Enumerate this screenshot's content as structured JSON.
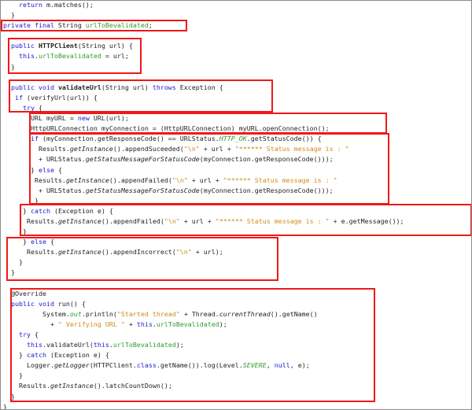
{
  "highlight_color": "#f01818",
  "lines": [
    [
      [
        "    return",
        "k"
      ],
      [
        " m.matches();",
        ""
      ]
    ],
    [
      [
        "  }",
        ""
      ]
    ],
    [
      [
        "private final",
        "k"
      ],
      [
        " String ",
        ""
      ],
      [
        "urlToBevalidated",
        "f"
      ],
      [
        ";",
        ""
      ]
    ],
    [],
    [
      [
        "  public",
        "k"
      ],
      [
        " ",
        ""
      ],
      [
        "HTTPClient",
        "b"
      ],
      [
        "(String url) {",
        ""
      ]
    ],
    [
      [
        "    this",
        "k"
      ],
      [
        ".",
        ""
      ],
      [
        "urlToBevalidated",
        "f"
      ],
      [
        " = url;",
        ""
      ]
    ],
    [
      [
        "  }",
        ""
      ]
    ],
    [],
    [
      [
        "  public void",
        "k"
      ],
      [
        " ",
        ""
      ],
      [
        "validateUrl",
        "b"
      ],
      [
        "(String url) ",
        ""
      ],
      [
        "throws",
        "k"
      ],
      [
        " Exception {",
        ""
      ]
    ],
    [
      [
        "   if",
        "k"
      ],
      [
        " (verifyUrl(url)) {",
        ""
      ]
    ],
    [
      [
        "     try",
        "k"
      ],
      [
        " {",
        ""
      ]
    ],
    [
      [
        "       URL myURL = ",
        ""
      ],
      [
        "new",
        "k"
      ],
      [
        " URL(url);",
        ""
      ]
    ],
    [
      [
        "       HttpURLConnection myConnection = (HttpURLConnection) myURL.openConnection();",
        ""
      ]
    ],
    [
      [
        "       if",
        "k"
      ],
      [
        " (myConnection.getResponseCode() == URLStatus.",
        ""
      ],
      [
        "HTTP_OK",
        "fi"
      ],
      [
        ".getStatusCode()) {",
        ""
      ]
    ],
    [
      [
        "         Results.",
        ""
      ],
      [
        "getInstance",
        "i"
      ],
      [
        "().appendSuceeded(",
        ""
      ],
      [
        "\"\\n\"",
        "s"
      ],
      [
        " + url + ",
        ""
      ],
      [
        "\"****** Status message is : \"",
        "s"
      ]
    ],
    [
      [
        "         + URLStatus.",
        ""
      ],
      [
        "getStatusMessageForStatusCode",
        "i"
      ],
      [
        "(myConnection.getResponseCode()));",
        ""
      ]
    ],
    [
      [
        "       } ",
        ""
      ],
      [
        "else",
        "k"
      ],
      [
        " {",
        ""
      ]
    ],
    [
      [
        "        Results.",
        ""
      ],
      [
        "getInstance",
        "i"
      ],
      [
        "().appendFailed(",
        ""
      ],
      [
        "\"\\n\"",
        "s"
      ],
      [
        " + url + ",
        ""
      ],
      [
        "\"****** Status message is : \"",
        "s"
      ]
    ],
    [
      [
        "         + URLStatus.",
        ""
      ],
      [
        "getStatusMessageForStatusCode",
        "i"
      ],
      [
        "(myConnection.getResponseCode()));",
        ""
      ]
    ],
    [
      [
        "        }",
        ""
      ]
    ],
    [
      [
        "     } ",
        ""
      ],
      [
        "catch",
        "k"
      ],
      [
        " (Exception e) {",
        ""
      ]
    ],
    [
      [
        "      Results.",
        ""
      ],
      [
        "getInstance",
        "i"
      ],
      [
        "().appendFailed(",
        ""
      ],
      [
        "\"\\n\"",
        "s"
      ],
      [
        " + url + ",
        ""
      ],
      [
        "\"****** Status message is : \"",
        "s"
      ],
      [
        " + e.getMessage());",
        ""
      ]
    ],
    [
      [
        "     }",
        ""
      ]
    ],
    [
      [
        "     } ",
        ""
      ],
      [
        "else",
        "k"
      ],
      [
        " {",
        ""
      ]
    ],
    [
      [
        "      Results.",
        ""
      ],
      [
        "getInstance",
        "i"
      ],
      [
        "().appendIncorrect(",
        ""
      ],
      [
        "\"\\n\"",
        "s"
      ],
      [
        " + url);",
        ""
      ]
    ],
    [
      [
        "    }",
        ""
      ]
    ],
    [
      [
        "  }",
        ""
      ]
    ],
    [],
    [
      [
        "  @Override",
        ""
      ]
    ],
    [
      [
        "  public void",
        "k"
      ],
      [
        " run() {",
        ""
      ]
    ],
    [
      [
        "          System.",
        ""
      ],
      [
        "out",
        "fi"
      ],
      [
        ".println(",
        ""
      ],
      [
        "\"Started thread\"",
        "s"
      ],
      [
        " + Thread.",
        ""
      ],
      [
        "currentThread",
        "i"
      ],
      [
        "().getName()",
        ""
      ]
    ],
    [
      [
        "            + ",
        ""
      ],
      [
        "\" Verifying URL \"",
        "s"
      ],
      [
        " + ",
        ""
      ],
      [
        "this",
        "k"
      ],
      [
        ".",
        ""
      ],
      [
        "urlToBevalidated",
        "f"
      ],
      [
        ");",
        ""
      ]
    ],
    [
      [
        "    try",
        "k"
      ],
      [
        " {",
        ""
      ]
    ],
    [
      [
        "      ",
        ""
      ],
      [
        "this",
        "k"
      ],
      [
        ".validateUrl(",
        ""
      ],
      [
        "this",
        "k"
      ],
      [
        ".",
        ""
      ],
      [
        "urlToBevalidated",
        "f"
      ],
      [
        ");",
        ""
      ]
    ],
    [
      [
        "    } ",
        ""
      ],
      [
        "catch",
        "k"
      ],
      [
        " (Exception e) {",
        ""
      ]
    ],
    [
      [
        "      Logger.",
        ""
      ],
      [
        "getLogger",
        "i"
      ],
      [
        "(HTTPClient.",
        ""
      ],
      [
        "class",
        "k"
      ],
      [
        ".getName()).log(Level.",
        ""
      ],
      [
        "SEVERE",
        "fi"
      ],
      [
        ", ",
        ""
      ],
      [
        "null",
        "k"
      ],
      [
        ", e);",
        ""
      ]
    ],
    [
      [
        "    }",
        ""
      ]
    ],
    [
      [
        "    Results.",
        ""
      ],
      [
        "getInstance",
        "i"
      ],
      [
        "().latchCountDown();",
        ""
      ]
    ],
    [
      [
        "  }",
        ""
      ]
    ],
    [
      [
        "}",
        ""
      ]
    ]
  ]
}
